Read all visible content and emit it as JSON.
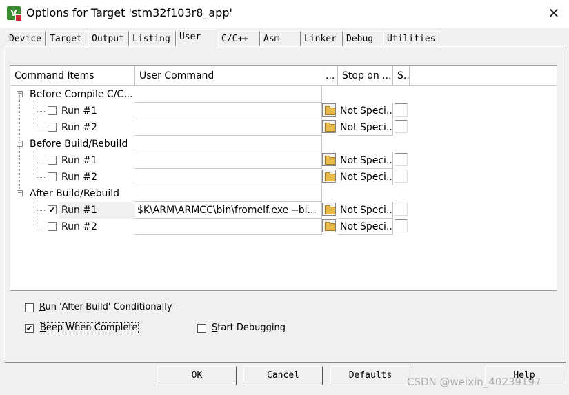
{
  "window": {
    "title": "Options for Target 'stm32f103r8_app'",
    "icon": "keil-uvision-icon",
    "close_glyph": "✕"
  },
  "tabs": [
    "Device",
    "Target",
    "Output",
    "Listing",
    "User",
    "C/C++",
    "Asm",
    "Linker",
    "Debug",
    "Utilities"
  ],
  "active_tab": "User",
  "grid": {
    "headers": {
      "items": "Command Items",
      "command": "User Command",
      "browse": "...",
      "stop": "Stop on ...",
      "s": "S..."
    },
    "groups": [
      {
        "label": "Before Compile C/C...",
        "runs": [
          {
            "label": "Run #1",
            "checked": false,
            "command": "",
            "stop": "Not Speci..."
          },
          {
            "label": "Run #2",
            "checked": false,
            "command": "",
            "stop": "Not Speci..."
          }
        ]
      },
      {
        "label": "Before Build/Rebuild",
        "runs": [
          {
            "label": "Run #1",
            "checked": false,
            "command": "",
            "stop": "Not Speci..."
          },
          {
            "label": "Run #2",
            "checked": false,
            "command": "",
            "stop": "Not Speci..."
          }
        ]
      },
      {
        "label": "After Build/Rebuild",
        "runs": [
          {
            "label": "Run #1",
            "checked": true,
            "command": "$K\\ARM\\ARMCC\\bin\\fromelf.exe --bi...",
            "stop": "Not Speci..."
          },
          {
            "label": "Run #2",
            "checked": false,
            "command": "",
            "stop": "Not Speci..."
          }
        ]
      }
    ]
  },
  "options": {
    "run_after_build": {
      "mnemonic": "R",
      "rest": "un 'After-Build' Conditionally",
      "checked": false
    },
    "beep": {
      "mnemonic": "B",
      "rest": "eep When Complete",
      "checked": true
    },
    "start_debug": {
      "mnemonic": "S",
      "rest": "tart Debugging",
      "checked": false
    }
  },
  "buttons": {
    "ok": "OK",
    "cancel": "Cancel",
    "defaults": "Defaults",
    "help": "Help"
  },
  "watermark": "CSDN @weixin_40239197",
  "check_glyph": "✔",
  "colors": {
    "icon_green": "#3a8d2f",
    "folder": "#e8b84a"
  }
}
